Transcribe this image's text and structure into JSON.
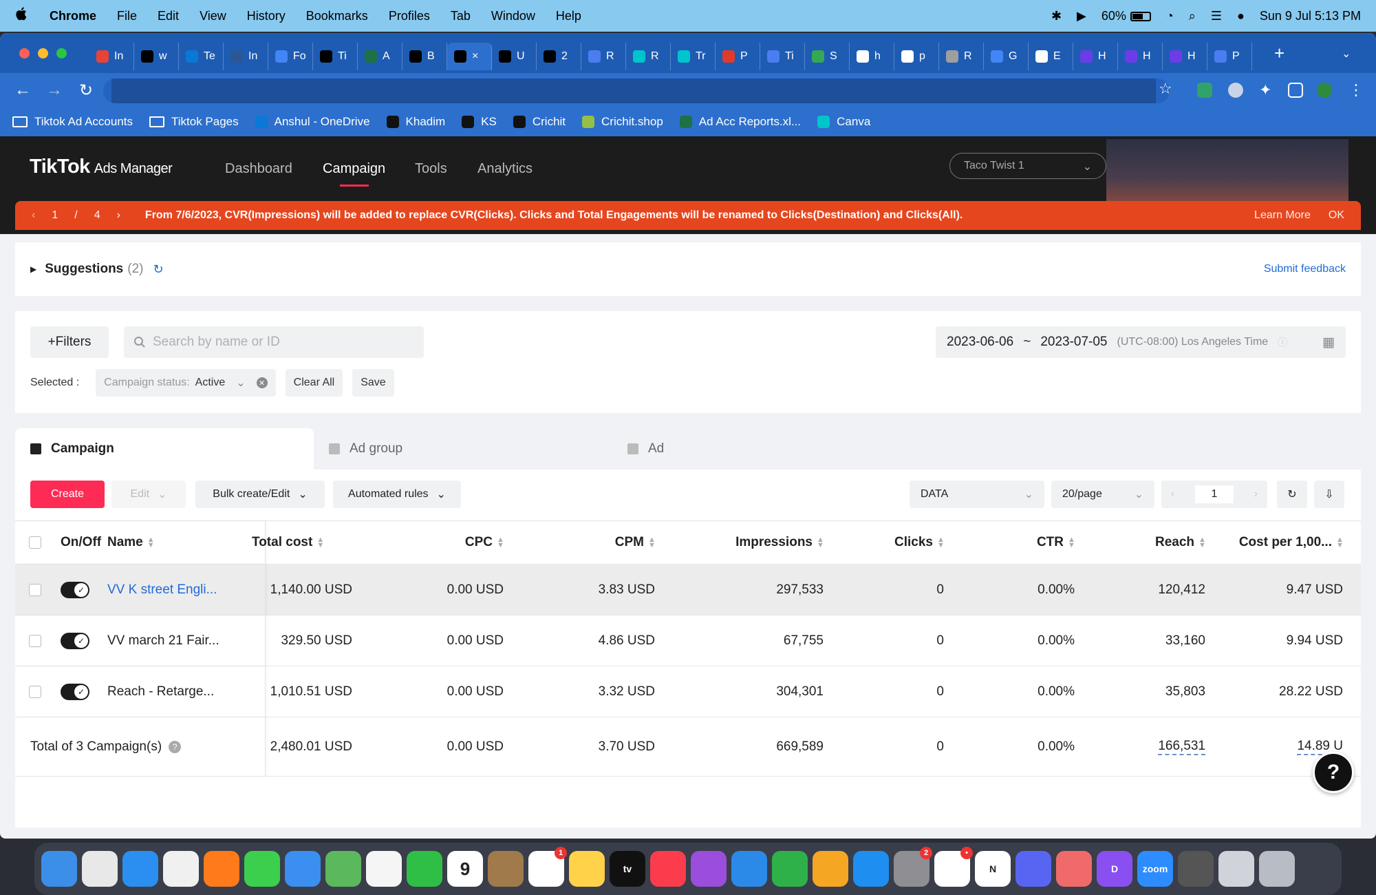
{
  "mac_menubar": {
    "app": "Chrome",
    "items": [
      "File",
      "Edit",
      "View",
      "History",
      "Bookmarks",
      "Profiles",
      "Tab",
      "Window",
      "Help"
    ],
    "battery": "60%",
    "datetime": "Sun 9 Jul  5:13 PM"
  },
  "browser": {
    "tabs": [
      {
        "label": "In",
        "icon": "gmail-icon",
        "color": "#ea4335"
      },
      {
        "label": "w",
        "icon": "tiktok-icon",
        "color": "#000000"
      },
      {
        "label": "Te",
        "icon": "onedrive-icon",
        "color": "#0a78d4"
      },
      {
        "label": "In",
        "icon": "word-icon",
        "color": "#2b5797"
      },
      {
        "label": "Fo",
        "icon": "docs-icon",
        "color": "#4285f4"
      },
      {
        "label": "Ti",
        "icon": "tiktok-icon",
        "color": "#000000"
      },
      {
        "label": "A",
        "icon": "excel-icon",
        "color": "#1e7145"
      },
      {
        "label": "B",
        "icon": "tiktok-icon",
        "color": "#000000"
      },
      {
        "label": "×",
        "icon": "tiktok-icon",
        "color": "#000000",
        "active": true
      },
      {
        "label": "U",
        "icon": "tiktok-icon",
        "color": "#000000"
      },
      {
        "label": "2",
        "icon": "tiktok-icon",
        "color": "#000000"
      },
      {
        "label": "R",
        "icon": "shield-icon",
        "color": "#4a7df0"
      },
      {
        "label": "R",
        "icon": "canva-icon",
        "color": "#00c4cc"
      },
      {
        "label": "Tr",
        "icon": "canva-icon",
        "color": "#00c4cc"
      },
      {
        "label": "P",
        "icon": "acrobat-icon",
        "color": "#e13a2b"
      },
      {
        "label": "Ti",
        "icon": "person-icon",
        "color": "#4a7df0"
      },
      {
        "label": "S",
        "icon": "maps-icon",
        "color": "#34a853"
      },
      {
        "label": "h",
        "icon": "google-icon",
        "color": "#ffffff"
      },
      {
        "label": "p",
        "icon": "google-icon",
        "color": "#ffffff"
      },
      {
        "label": "R",
        "icon": "page-icon",
        "color": "#9e9e9e"
      },
      {
        "label": "G",
        "icon": "docs-icon",
        "color": "#4285f4"
      },
      {
        "label": "E",
        "icon": "google-icon",
        "color": "#ffffff"
      },
      {
        "label": "H",
        "icon": "klaviyo-icon",
        "color": "#6c3ce9"
      },
      {
        "label": "H",
        "icon": "klaviyo-icon",
        "color": "#6c3ce9"
      },
      {
        "label": "H",
        "icon": "klaviyo-icon",
        "color": "#6c3ce9"
      },
      {
        "label": "P",
        "icon": "x-circle-icon",
        "color": "#4a7df0"
      }
    ],
    "new_tab": "+",
    "bookmarks": [
      {
        "label": "Tiktok Ad Accounts",
        "icon": "folder-icon"
      },
      {
        "label": "Tiktok Pages",
        "icon": "folder-icon"
      },
      {
        "label": "Anshul - OneDrive",
        "icon": "onedrive-icon"
      },
      {
        "label": "Khadim",
        "icon": "tiktok-icon"
      },
      {
        "label": "KS",
        "icon": "tiktok-icon"
      },
      {
        "label": "Crichit",
        "icon": "tiktok-icon"
      },
      {
        "label": "Crichit.shop",
        "icon": "shopify-icon"
      },
      {
        "label": "Ad Acc Reports.xl...",
        "icon": "excel-icon"
      },
      {
        "label": "Canva",
        "icon": "canva-icon"
      }
    ]
  },
  "app": {
    "logo": "TikTok",
    "logo_suffix": "Ads Manager",
    "nav": [
      "Dashboard",
      "Campaign",
      "Tools",
      "Analytics"
    ],
    "active_nav": "Campaign",
    "account": "Taco Twist 1"
  },
  "banner": {
    "page_current": "1",
    "page_sep": "/",
    "page_total": "4",
    "message": "From 7/6/2023, CVR(Impressions) will be added to replace CVR(Clicks). Clicks and Total Engagements will be renamed to Clicks(Destination) and Clicks(All).",
    "learn_more": "Learn More",
    "ok": "OK"
  },
  "suggestions": {
    "title": "Suggestions",
    "count": "(2)",
    "feedback": "Submit feedback"
  },
  "filters": {
    "filters_label": "+Filters",
    "search_placeholder": "Search by name or ID",
    "date_start": "2023-06-06",
    "date_sep": "~",
    "date_end": "2023-07-05",
    "timezone": "(UTC-08:00) Los Angeles Time",
    "selected_label": "Selected :",
    "chip_key": "Campaign status:",
    "chip_value": "Active",
    "clear_all": "Clear All",
    "save": "Save"
  },
  "level_tabs": [
    "Campaign",
    "Ad group",
    "Ad"
  ],
  "actions": {
    "create": "Create",
    "edit": "Edit",
    "bulk": "Bulk create/Edit",
    "rules": "Automated rules",
    "data_select": "DATA",
    "per_page": "20/page",
    "page": "1"
  },
  "table": {
    "headers": {
      "onoff": "On/Off",
      "name": "Name",
      "cost": "Total cost",
      "cpc": "CPC",
      "cpm": "CPM",
      "impressions": "Impressions",
      "clicks": "Clicks",
      "ctr": "CTR",
      "reach": "Reach",
      "cpr": "Cost per 1,00..."
    },
    "rows": [
      {
        "name": "VV K street Engli...",
        "cost": "1,140.00 USD",
        "cpc": "0.00 USD",
        "cpm": "3.83 USD",
        "impressions": "297,533",
        "clicks": "0",
        "ctr": "0.00%",
        "reach": "120,412",
        "cpr": "9.47 USD"
      },
      {
        "name": "VV march 21 Fair...",
        "cost": "329.50 USD",
        "cpc": "0.00 USD",
        "cpm": "4.86 USD",
        "impressions": "67,755",
        "clicks": "0",
        "ctr": "0.00%",
        "reach": "33,160",
        "cpr": "9.94 USD"
      },
      {
        "name": "Reach - Retarge...",
        "cost": "1,010.51 USD",
        "cpc": "0.00 USD",
        "cpm": "3.32 USD",
        "impressions": "304,301",
        "clicks": "0",
        "ctr": "0.00%",
        "reach": "35,803",
        "cpr": "28.22 USD"
      }
    ],
    "total": {
      "label": "Total of 3 Campaign(s)",
      "cost": "2,480.01 USD",
      "cpc": "0.00 USD",
      "cpm": "3.70 USD",
      "impressions": "669,589",
      "clicks": "0",
      "ctr": "0.00%",
      "reach": "166,531",
      "cpr": "14.89 U"
    }
  },
  "dock": [
    {
      "name": "finder-icon",
      "color": "#3b8fe8"
    },
    {
      "name": "launchpad-icon",
      "color": "#e8e8e8"
    },
    {
      "name": "safari-icon",
      "color": "#2a8ff0"
    },
    {
      "name": "chrome-icon",
      "color": "#f0f0f0"
    },
    {
      "name": "firefox-icon",
      "color": "#ff7a1a"
    },
    {
      "name": "messages-icon",
      "color": "#3ccf4e"
    },
    {
      "name": "mail-icon",
      "color": "#3a8ff0"
    },
    {
      "name": "maps-icon",
      "color": "#5bb85c"
    },
    {
      "name": "photos-icon",
      "color": "#f5f5f5"
    },
    {
      "name": "facetime-icon",
      "color": "#2fbf46"
    },
    {
      "name": "calendar-icon",
      "color": "#ffffff",
      "text": "9"
    },
    {
      "name": "notes-brown-icon",
      "color": "#a07a4a"
    },
    {
      "name": "reminders-icon",
      "color": "#ffffff",
      "badge": "1"
    },
    {
      "name": "notes-icon",
      "color": "#ffd24a"
    },
    {
      "name": "apple-tv-icon",
      "color": "#111111",
      "text": "tv"
    },
    {
      "name": "music-icon",
      "color": "#fa3c4c"
    },
    {
      "name": "podcasts-icon",
      "color": "#9b4ddb"
    },
    {
      "name": "keynote-icon",
      "color": "#2b8ae8"
    },
    {
      "name": "numbers-icon",
      "color": "#2fb14a"
    },
    {
      "name": "pages-icon",
      "color": "#f5a623"
    },
    {
      "name": "app-store-icon",
      "color": "#1f8ef1"
    },
    {
      "name": "system-settings-icon",
      "color": "#8e8e93",
      "badge": "2"
    },
    {
      "name": "slack-icon",
      "color": "#ffffff",
      "badge": "•"
    },
    {
      "name": "notion-icon",
      "color": "#ffffff",
      "text": "N"
    },
    {
      "name": "discord-icon",
      "color": "#5865f2"
    },
    {
      "name": "asana-icon",
      "color": "#f06a6a"
    },
    {
      "name": "dribbble-icon",
      "color": "#8a4ff0",
      "text": "D"
    },
    {
      "name": "zoom-icon",
      "color": "#2d8cff",
      "text": "zoom"
    },
    {
      "name": "calculator-icon",
      "color": "#555555"
    },
    {
      "name": "preview-icon",
      "color": "#d0d4da"
    },
    {
      "name": "trash-icon",
      "color": "#b8bcc4"
    }
  ]
}
